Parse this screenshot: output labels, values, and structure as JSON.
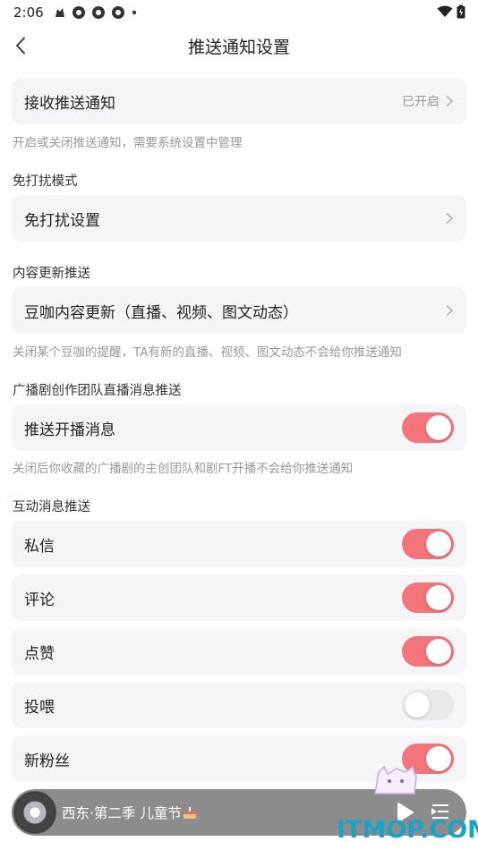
{
  "status_bar": {
    "time": "2:06"
  },
  "header": {
    "title": "推送通知设置"
  },
  "receive": {
    "label": "接收推送通知",
    "value": "已开启",
    "hint": "开启或关闭推送通知，需要系统设置中管理"
  },
  "dnd": {
    "section": "免打扰模式",
    "label": "免打扰设置"
  },
  "content_update": {
    "section": "内容更新推送",
    "label": "豆咖内容更新（直播、视频、图文动态）",
    "hint": "关闭某个豆咖的提醒，TA有新的直播、视频、图文动态不会给你推送通知"
  },
  "broadcast": {
    "section": "广播剧创作团队直播消息推送",
    "label": "推送开播消息",
    "enabled": true,
    "hint": "关闭后你收藏的广播剧的主创团队和剧FT开播不会给你推送通知"
  },
  "interaction": {
    "section": "互动消息推送",
    "items": [
      {
        "label": "私信",
        "enabled": true
      },
      {
        "label": "评论",
        "enabled": true
      },
      {
        "label": "点赞",
        "enabled": true
      },
      {
        "label": "投喂",
        "enabled": false
      },
      {
        "label": "新粉丝",
        "enabled": true
      }
    ]
  },
  "player": {
    "title": "西东·第二季 儿童节"
  },
  "watermark": {
    "text": "ITMOP.COM"
  },
  "colors": {
    "toggle_on": "#f37479",
    "toggle_off": "#e9e9ea",
    "card_bg": "#f5f5f7",
    "watermark": "#1aa3c7"
  }
}
